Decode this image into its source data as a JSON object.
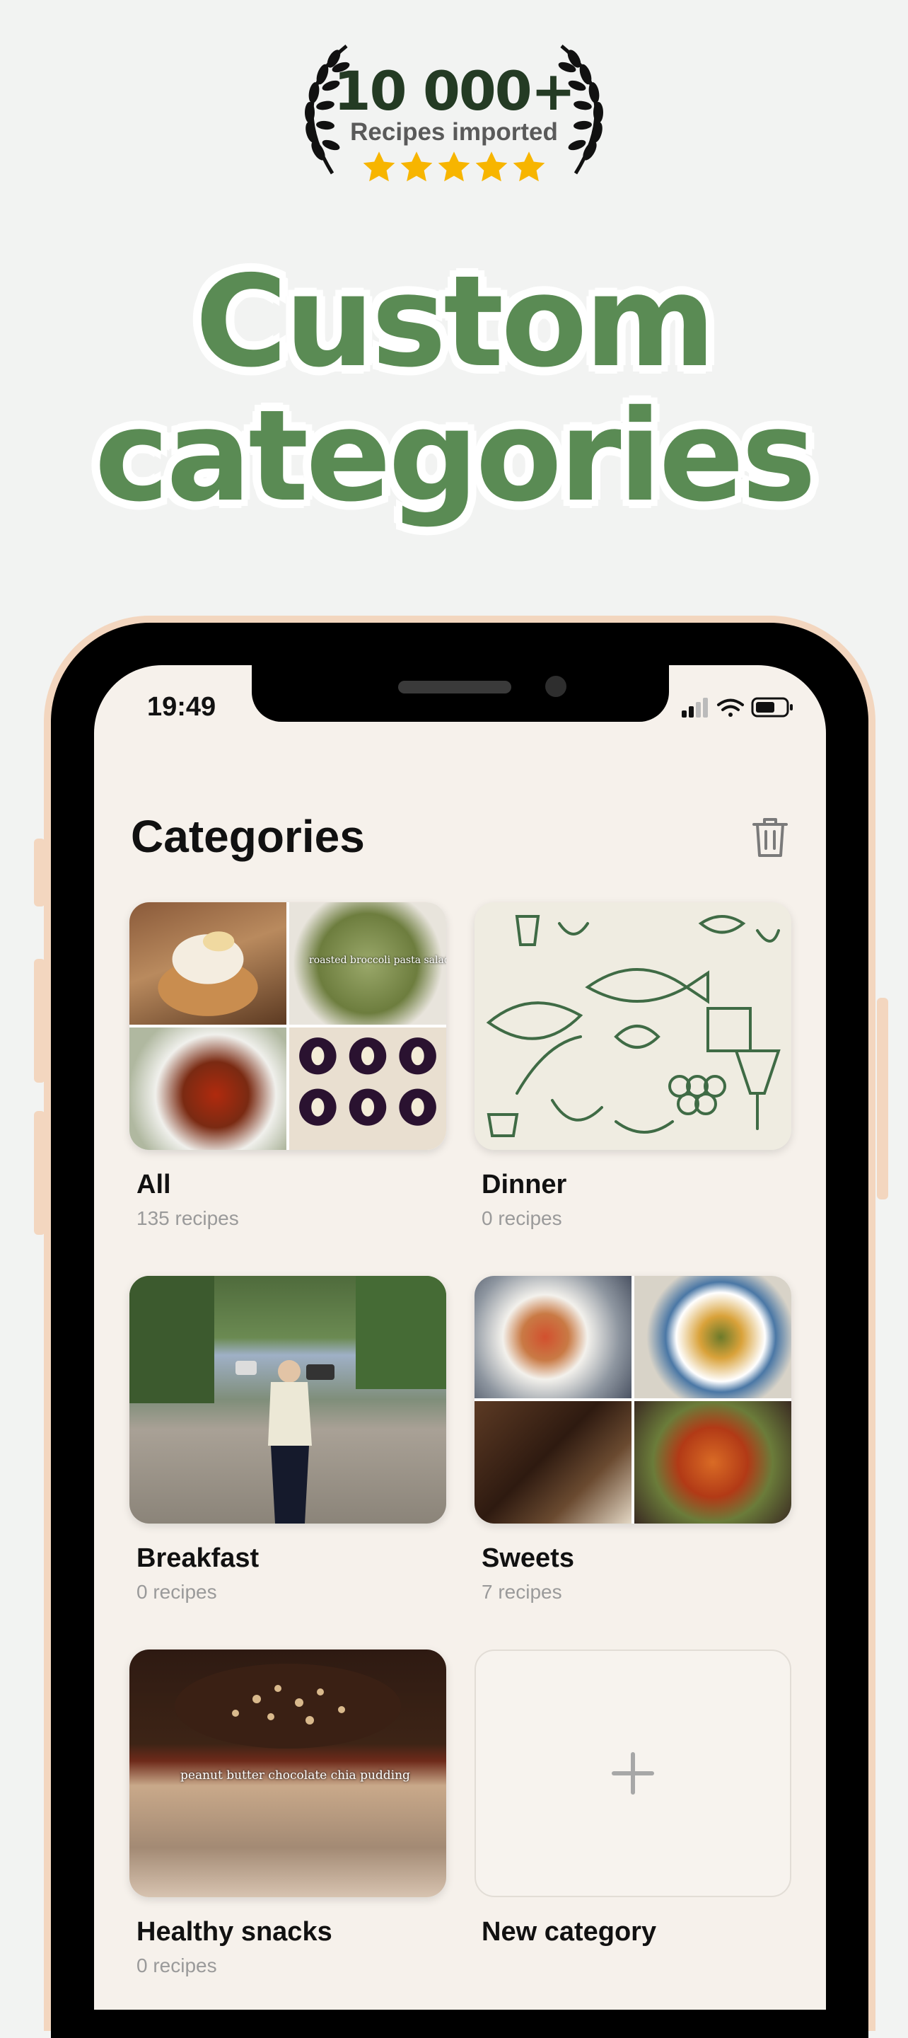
{
  "badge": {
    "count": "10 000+",
    "label": "Recipes imported",
    "stars": 5,
    "star_color": "#f7b500"
  },
  "headline": {
    "line1": "Custom",
    "line2": "categories",
    "color": "#5a8b54"
  },
  "status_bar": {
    "time": "19:49"
  },
  "page": {
    "title": "Categories"
  },
  "categories": [
    {
      "name": "All",
      "count": "135 recipes",
      "overlay": "roasted broccoli pasta salad"
    },
    {
      "name": "Dinner",
      "count": "0 recipes"
    },
    {
      "name": "Breakfast",
      "count": "0 recipes"
    },
    {
      "name": "Sweets",
      "count": "7 recipes"
    },
    {
      "name": "Healthy snacks",
      "count": "0 recipes",
      "overlay": "peanut butter chocolate chia pudding"
    },
    {
      "name": "New category"
    }
  ]
}
